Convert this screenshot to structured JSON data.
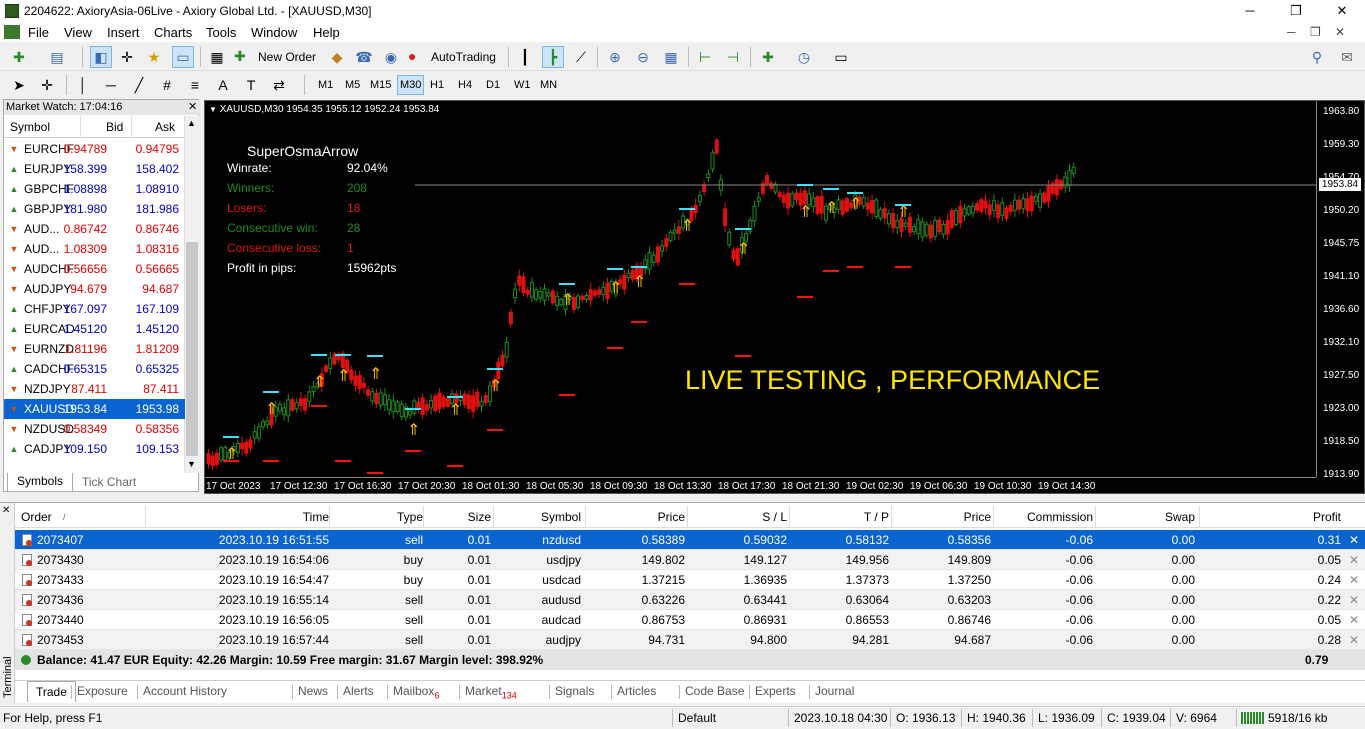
{
  "window": {
    "title": "2204622: AxioryAsia-06Live - Axiory Global Ltd. - [XAUUSD,M30]"
  },
  "menu": [
    "File",
    "View",
    "Insert",
    "Charts",
    "Tools",
    "Window",
    "Help"
  ],
  "toolbar": {
    "new_order": "New Order",
    "autotrading": "AutoTrading",
    "timeframes": [
      "M1",
      "M5",
      "M15",
      "M30",
      "H1",
      "H4",
      "D1",
      "W1",
      "MN"
    ],
    "active_timeframe": "M30"
  },
  "market_watch": {
    "header": "Market Watch: 17:04:16",
    "col_symbol": "Symbol",
    "col_bid": "Bid",
    "col_ask": "Ask",
    "rows": [
      {
        "symbol": "EURCHF",
        "bid": "0.94789",
        "ask": "0.94795",
        "dir": "down"
      },
      {
        "symbol": "EURJPY",
        "bid": "158.399",
        "ask": "158.402",
        "dir": "up"
      },
      {
        "symbol": "GBPCHF",
        "bid": "1.08898",
        "ask": "1.08910",
        "dir": "up"
      },
      {
        "symbol": "GBPJPY",
        "bid": "181.980",
        "ask": "181.986",
        "dir": "up"
      },
      {
        "symbol": "AUD...",
        "bid": "0.86742",
        "ask": "0.86746",
        "dir": "down"
      },
      {
        "symbol": "AUD...",
        "bid": "1.08309",
        "ask": "1.08316",
        "dir": "down"
      },
      {
        "symbol": "AUDCHF",
        "bid": "0.56656",
        "ask": "0.56665",
        "dir": "down"
      },
      {
        "symbol": "AUDJPY",
        "bid": "94.679",
        "ask": "94.687",
        "dir": "down"
      },
      {
        "symbol": "CHFJPY",
        "bid": "167.097",
        "ask": "167.109",
        "dir": "up"
      },
      {
        "symbol": "EURCAD",
        "bid": "1.45120",
        "ask": "1.45120",
        "dir": "up"
      },
      {
        "symbol": "EURNZD",
        "bid": "1.81196",
        "ask": "1.81209",
        "dir": "down"
      },
      {
        "symbol": "CADCHF",
        "bid": "0.65315",
        "ask": "0.65325",
        "dir": "up"
      },
      {
        "symbol": "NZDJPY",
        "bid": "87.411",
        "ask": "87.411",
        "dir": "down"
      },
      {
        "symbol": "XAUUSD",
        "bid": "1953.84",
        "ask": "1953.98",
        "dir": "down"
      },
      {
        "symbol": "NZDUSD",
        "bid": "0.58349",
        "ask": "0.58356",
        "dir": "down"
      },
      {
        "symbol": "CADJPY",
        "bid": "109.150",
        "ask": "109.153",
        "dir": "up"
      }
    ],
    "tabs": [
      "Symbols",
      "Tick Chart"
    ]
  },
  "chart": {
    "info": "XAUUSD,M30  1954.35 1955.12 1952.24 1953.84",
    "indicator_title": "SuperOsmaArrow",
    "stats": [
      {
        "label": "Winrate:",
        "value": "92.04%",
        "color": "#ffffff"
      },
      {
        "label": "Winners:",
        "value": "208",
        "color": "#1e8c1e"
      },
      {
        "label": "Losers:",
        "value": "18",
        "color": "#e01010"
      },
      {
        "label": "Consecutive win:",
        "value": "28",
        "color": "#1e8c1e"
      },
      {
        "label": "Consecutive loss:",
        "value": "1",
        "color": "#e01010"
      },
      {
        "label": "Profit in pips:",
        "value": "15962pts",
        "color": "#ffffff"
      }
    ],
    "overlay_text": "LIVE TESTING , PERFORMANCE",
    "current_price": "1953.84",
    "price_ticks": [
      "1963.80",
      "1959.30",
      "1954.70",
      "1950.20",
      "1945.75",
      "1941.10",
      "1936.60",
      "1932.10",
      "1927.50",
      "1923.00",
      "1918.50",
      "1913.90"
    ],
    "time_ticks": [
      "17 Oct 2023",
      "17 Oct 12:30",
      "17 Oct 16:30",
      "17 Oct 20:30",
      "18 Oct 01:30",
      "18 Oct 05:30",
      "18 Oct 09:30",
      "18 Oct 13:30",
      "18 Oct 17:30",
      "18 Oct 21:30",
      "19 Oct 02:30",
      "19 Oct 06:30",
      "19 Oct 10:30",
      "19 Oct 14:30"
    ]
  },
  "terminal": {
    "side_label": "Terminal",
    "columns": [
      "Order",
      "Time",
      "Type",
      "Size",
      "Symbol",
      "Price",
      "S / L",
      "T / P",
      "Price",
      "Commission",
      "Swap",
      "Profit"
    ],
    "rows": [
      {
        "order": "2073407",
        "time": "2023.10.19 16:51:55",
        "type": "sell",
        "size": "0.01",
        "symbol": "nzdusd",
        "price": "0.58389",
        "sl": "0.59032",
        "tp": "0.58132",
        "cur": "0.58356",
        "comm": "-0.06",
        "swap": "0.00",
        "profit": "0.31"
      },
      {
        "order": "2073430",
        "time": "2023.10.19 16:54:06",
        "type": "buy",
        "size": "0.01",
        "symbol": "usdjpy",
        "price": "149.802",
        "sl": "149.127",
        "tp": "149.956",
        "cur": "149.809",
        "comm": "-0.06",
        "swap": "0.00",
        "profit": "0.05"
      },
      {
        "order": "2073433",
        "time": "2023.10.19 16:54:47",
        "type": "buy",
        "size": "0.01",
        "symbol": "usdcad",
        "price": "1.37215",
        "sl": "1.36935",
        "tp": "1.37373",
        "cur": "1.37250",
        "comm": "-0.06",
        "swap": "0.00",
        "profit": "0.24"
      },
      {
        "order": "2073436",
        "time": "2023.10.19 16:55:14",
        "type": "sell",
        "size": "0.01",
        "symbol": "audusd",
        "price": "0.63226",
        "sl": "0.63441",
        "tp": "0.63064",
        "cur": "0.63203",
        "comm": "-0.06",
        "swap": "0.00",
        "profit": "0.22"
      },
      {
        "order": "2073440",
        "time": "2023.10.19 16:56:05",
        "type": "sell",
        "size": "0.01",
        "symbol": "audcad",
        "price": "0.86753",
        "sl": "0.86931",
        "tp": "0.86553",
        "cur": "0.86746",
        "comm": "-0.06",
        "swap": "0.00",
        "profit": "0.05"
      },
      {
        "order": "2073453",
        "time": "2023.10.19 16:57:44",
        "type": "sell",
        "size": "0.01",
        "symbol": "audjpy",
        "price": "94.731",
        "sl": "94.800",
        "tp": "94.281",
        "cur": "94.687",
        "comm": "-0.06",
        "swap": "0.00",
        "profit": "0.28"
      }
    ],
    "balance_line": "Balance: 41.47 EUR  Equity: 42.26  Margin: 10.59  Free margin: 31.67  Margin level: 398.92%",
    "total_profit": "0.79",
    "tabs": [
      {
        "label": "Trade",
        "badge": ""
      },
      {
        "label": "Exposure",
        "badge": ""
      },
      {
        "label": "Account History",
        "badge": ""
      },
      {
        "label": "News",
        "badge": ""
      },
      {
        "label": "Alerts",
        "badge": ""
      },
      {
        "label": "Mailbox",
        "badge": "6"
      },
      {
        "label": "Market",
        "badge": "134"
      },
      {
        "label": "Signals",
        "badge": ""
      },
      {
        "label": "Articles",
        "badge": ""
      },
      {
        "label": "Code Base",
        "badge": ""
      },
      {
        "label": "Experts",
        "badge": ""
      },
      {
        "label": "Journal",
        "badge": ""
      }
    ]
  },
  "status": {
    "help": "For Help, press F1",
    "profile": "Default",
    "datetime": "2023.10.18 04:30",
    "open": "O: 1936.13",
    "high": "H: 1940.36",
    "low": "L: 1936.09",
    "close": "C: 1939.04",
    "volume": "V: 6964",
    "traffic": "5918/16 kb"
  },
  "colors": {
    "bull": "#1e8c1e",
    "bear": "#e01010",
    "signal_arrow": "#ffc000",
    "tp_line": "#40e0ff",
    "sl_mark": "#ff1010",
    "selection": "#0a64d0"
  }
}
